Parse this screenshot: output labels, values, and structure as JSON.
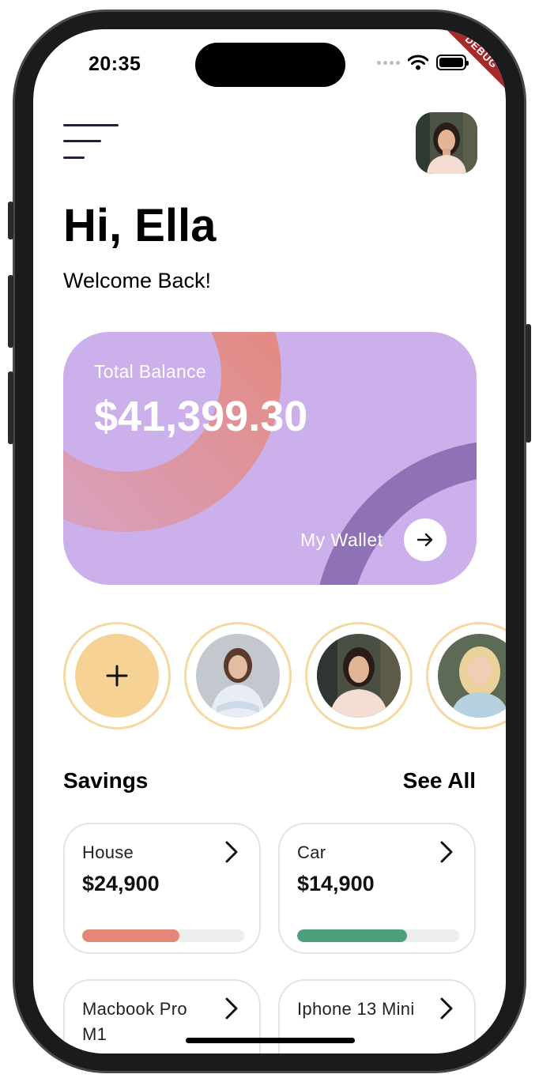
{
  "status_bar": {
    "time": "20:35"
  },
  "debug_banner": "DEBUG",
  "header": {
    "menu_icon": "hamburger-menu-icon",
    "avatar": "user-avatar"
  },
  "greeting": {
    "title": "Hi, Ella",
    "subtitle": "Welcome Back!"
  },
  "balance_card": {
    "label": "Total Balance",
    "amount": "$41,399.30",
    "wallet_label": "My Wallet",
    "wallet_icon": "arrow-right-icon",
    "colors": {
      "background": "#cbb0ec",
      "accent": "#e4877a"
    }
  },
  "contacts": {
    "add_icon": "plus-icon",
    "items": [
      {
        "name": "contact-1"
      },
      {
        "name": "contact-2"
      },
      {
        "name": "contact-3"
      }
    ]
  },
  "savings": {
    "title": "Savings",
    "see_all": "See All",
    "items": [
      {
        "name": "House",
        "amount": "$24,900",
        "progress": 0.6,
        "color": "#e4877a"
      },
      {
        "name": "Car",
        "amount": "$14,900",
        "progress": 0.68,
        "color": "#4f9e7a"
      },
      {
        "name": "Macbook Pro M1",
        "amount": "",
        "progress": 0,
        "color": "#e4877a"
      },
      {
        "name": "Iphone 13 Mini",
        "amount": "",
        "progress": 0,
        "color": "#4f9e7a"
      }
    ]
  }
}
